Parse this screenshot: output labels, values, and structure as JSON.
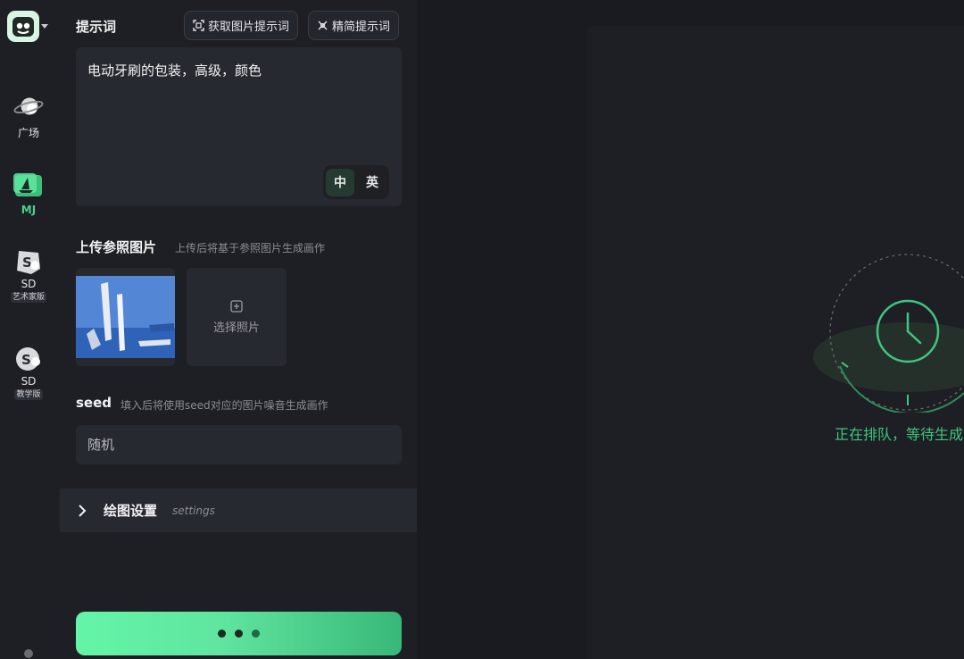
{
  "sidebar": {
    "items": [
      {
        "label": "广场",
        "sub": "",
        "icon": "planet-icon"
      },
      {
        "label": "MJ",
        "sub": "",
        "icon": "sailboat-icon"
      },
      {
        "label": "SD",
        "sub": "艺术家版",
        "icon": "sd-art-icon"
      },
      {
        "label": "SD",
        "sub": "教学版",
        "icon": "sd-teach-icon"
      }
    ],
    "active": "MJ"
  },
  "prompt": {
    "title": "提示词",
    "get_image_prompt_label": "获取图片提示词",
    "simplify_prompt_label": "精简提示词",
    "text": "电动牙刷的包装，高级，颜色",
    "lang_zh": "中",
    "lang_en": "英",
    "lang_selected": "中"
  },
  "reference": {
    "title": "上传参照图片",
    "hint": "上传后将基于参照图片生成画作",
    "select_label": "选择照片"
  },
  "seed": {
    "title": "seed",
    "hint": "填入后将使用seed对应的图片噪音生成画作",
    "placeholder": "随机"
  },
  "settings": {
    "title": "绘图设置",
    "subtitle": "settings"
  },
  "status": {
    "text": "正在排队，等待生成中"
  },
  "colors": {
    "accent": "#4fd08c",
    "button_gradient_start": "#64f5a8",
    "button_gradient_end": "#38b878",
    "panel_bg": "#1e1f24",
    "input_bg": "#272930"
  }
}
